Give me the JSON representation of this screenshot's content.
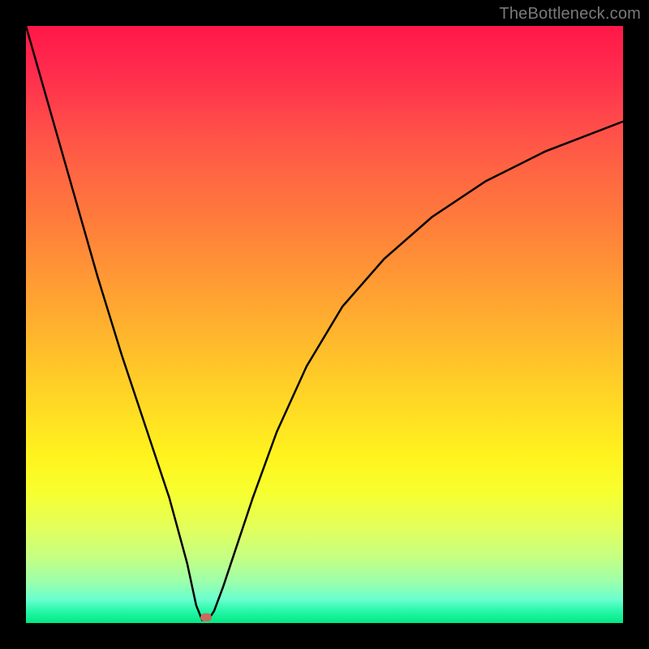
{
  "watermark": "TheBottleneck.com",
  "marker": {
    "x_pct": 30.2,
    "y_pct": 99.1
  },
  "chart_data": {
    "type": "line",
    "title": "",
    "xlabel": "",
    "ylabel": "",
    "xlim": [
      0,
      100
    ],
    "ylim": [
      0,
      100
    ],
    "series": [
      {
        "name": "curve",
        "x": [
          0,
          4,
          8,
          12,
          16,
          20,
          24,
          27,
          28.5,
          29.5,
          30.5,
          31.5,
          33,
          35,
          38,
          42,
          47,
          53,
          60,
          68,
          77,
          87,
          100
        ],
        "y": [
          100,
          86,
          72,
          58,
          45,
          33,
          21,
          10,
          3,
          0.5,
          0.5,
          2,
          6,
          12,
          21,
          32,
          43,
          53,
          61,
          68,
          74,
          79,
          84
        ]
      }
    ],
    "annotations": [
      {
        "type": "point",
        "name": "marker",
        "x": 30.2,
        "y": 0.9,
        "color": "#c86a5d"
      }
    ],
    "background_gradient": {
      "direction": "vertical",
      "stops": [
        {
          "pos": 0.0,
          "color": "#ff1749"
        },
        {
          "pos": 0.5,
          "color": "#ffb02c"
        },
        {
          "pos": 0.75,
          "color": "#fff31e"
        },
        {
          "pos": 1.0,
          "color": "#00e884"
        }
      ]
    }
  }
}
